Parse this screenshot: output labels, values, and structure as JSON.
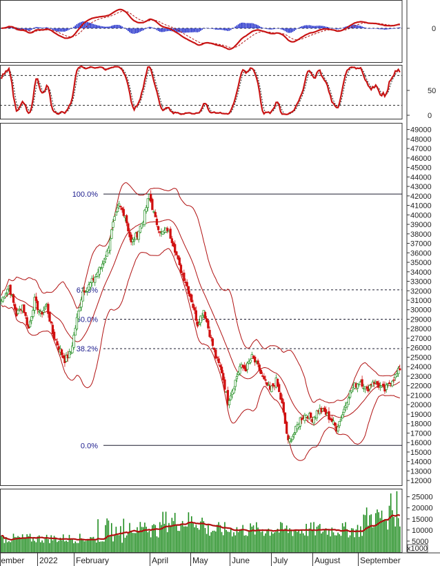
{
  "chart_data": {
    "type": "candlestick",
    "x_labels": [
      "December",
      "2022",
      "February",
      "April",
      "May",
      "June",
      "July",
      "August",
      "September"
    ],
    "price_axis": {
      "range": [
        11500,
        49700
      ],
      "ticks": [
        12000,
        13000,
        14000,
        15000,
        16000,
        17000,
        18000,
        19000,
        20000,
        21000,
        22000,
        23000,
        24000,
        25000,
        26000,
        27000,
        28000,
        29000,
        30000,
        31000,
        32000,
        33000,
        34000,
        35000,
        36000,
        37000,
        38000,
        39000,
        40000,
        41000,
        42000,
        43000,
        44000,
        45000,
        46000,
        47000,
        48000,
        49000
      ]
    },
    "fibonacci_levels": [
      {
        "label": "100.0%",
        "price": 42200
      },
      {
        "label": "61.8%",
        "price": 32100
      },
      {
        "label": "50.0%",
        "price": 29000
      },
      {
        "label": "38.2%",
        "price": 25900
      },
      {
        "label": "0.0%",
        "price": 15700
      }
    ],
    "close_anchors": [
      [
        0,
        31000
      ],
      [
        5,
        32500
      ],
      [
        10,
        29500
      ],
      [
        14,
        30500
      ],
      [
        18,
        28000
      ],
      [
        22,
        31000
      ],
      [
        26,
        29500
      ],
      [
        30,
        30500
      ],
      [
        34,
        27500
      ],
      [
        38,
        26000
      ],
      [
        42,
        24700
      ],
      [
        46,
        25500
      ],
      [
        50,
        29000
      ],
      [
        54,
        32000
      ],
      [
        58,
        32500
      ],
      [
        62,
        33500
      ],
      [
        66,
        34500
      ],
      [
        70,
        36000
      ],
      [
        74,
        39000
      ],
      [
        78,
        41000
      ],
      [
        82,
        40000
      ],
      [
        86,
        37000
      ],
      [
        90,
        38000
      ],
      [
        94,
        39500
      ],
      [
        98,
        42100
      ],
      [
        102,
        39500
      ],
      [
        106,
        38000
      ],
      [
        110,
        38500
      ],
      [
        114,
        37000
      ],
      [
        118,
        34500
      ],
      [
        122,
        33000
      ],
      [
        126,
        31000
      ],
      [
        130,
        28500
      ],
      [
        134,
        30000
      ],
      [
        138,
        27500
      ],
      [
        142,
        25000
      ],
      [
        146,
        23500
      ],
      [
        150,
        20300
      ],
      [
        154,
        22000
      ],
      [
        158,
        24000
      ],
      [
        162,
        23800
      ],
      [
        166,
        25000
      ],
      [
        170,
        24000
      ],
      [
        174,
        22500
      ],
      [
        178,
        21500
      ],
      [
        182,
        22500
      ],
      [
        186,
        20000
      ],
      [
        190,
        16000
      ],
      [
        194,
        17000
      ],
      [
        198,
        18500
      ],
      [
        202,
        19000
      ],
      [
        206,
        18500
      ],
      [
        210,
        19500
      ],
      [
        214,
        19200
      ],
      [
        218,
        18500
      ],
      [
        222,
        17500
      ],
      [
        226,
        19000
      ],
      [
        230,
        21000
      ],
      [
        234,
        22000
      ],
      [
        238,
        22500
      ],
      [
        242,
        21500
      ],
      [
        246,
        22500
      ],
      [
        250,
        22000
      ],
      [
        254,
        21500
      ],
      [
        258,
        22500
      ],
      [
        262,
        23200
      ],
      [
        264,
        23800
      ]
    ],
    "volume_axis": {
      "ticks": [
        5000,
        10000,
        15000,
        20000,
        25000
      ],
      "unit_label": "x1000",
      "range": [
        0,
        28000
      ]
    },
    "macd_axis": {
      "ticks": [
        0
      ]
    },
    "stoch_axis": {
      "ticks": [
        0,
        50
      ],
      "levels": [
        20,
        80
      ]
    }
  }
}
